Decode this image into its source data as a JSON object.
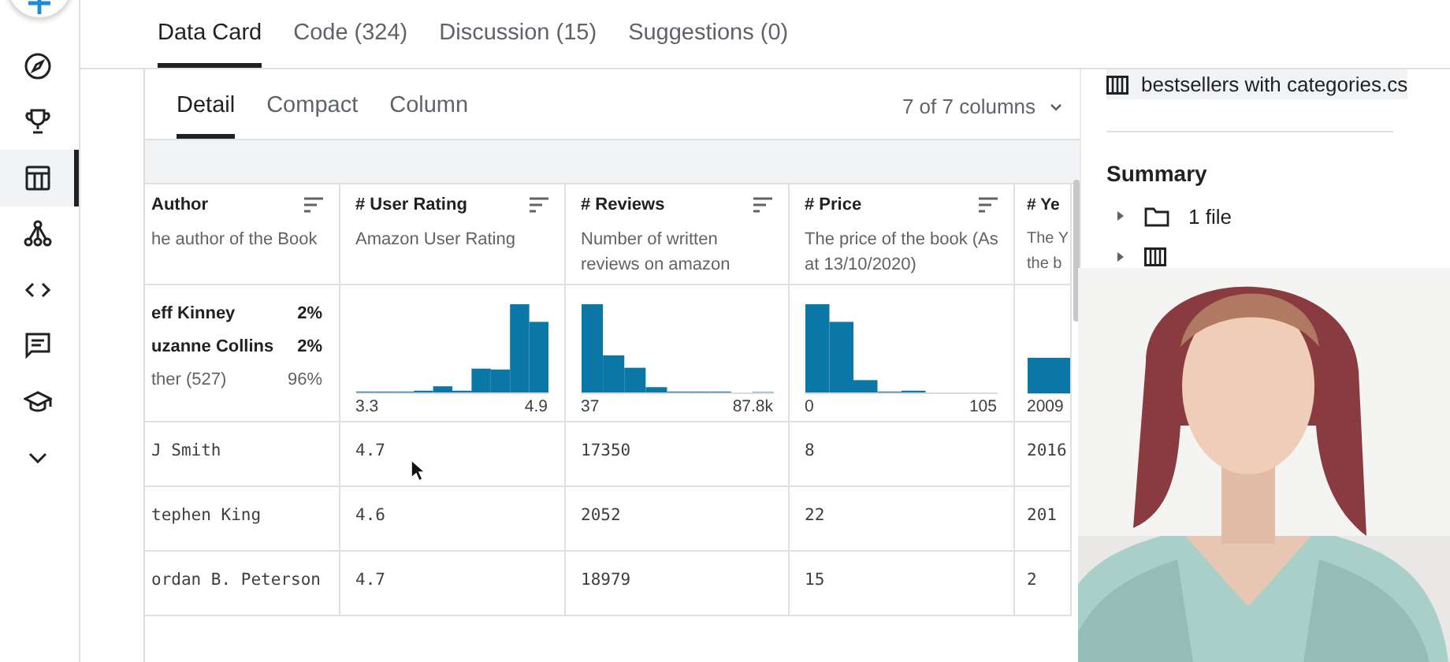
{
  "nav_rail": {
    "items": [
      {
        "kind": "compass",
        "selected": false
      },
      {
        "kind": "trophy",
        "selected": false
      },
      {
        "kind": "table",
        "selected": true
      },
      {
        "kind": "network",
        "selected": false
      },
      {
        "kind": "code",
        "selected": false
      },
      {
        "kind": "comments",
        "selected": false
      },
      {
        "kind": "school",
        "selected": false
      },
      {
        "kind": "more",
        "selected": false
      }
    ]
  },
  "tabs": [
    {
      "label": "Data Card",
      "selected": true
    },
    {
      "label": "Code (324)",
      "selected": false
    },
    {
      "label": "Discussion (15)",
      "selected": false
    },
    {
      "label": "Suggestions (0)",
      "selected": false
    }
  ],
  "view_tabs": [
    {
      "label": "Detail",
      "selected": true
    },
    {
      "label": "Compact",
      "selected": false
    },
    {
      "label": "Column",
      "selected": false
    }
  ],
  "columns_menu": "7 of 7 columns",
  "table": {
    "columns": [
      {
        "kind": "text",
        "name": "Author",
        "sortable": true,
        "description": [
          "he author of the Book"
        ],
        "top_values": [
          {
            "label": "eff Kinney",
            "share": "2%",
            "kind": "value"
          },
          {
            "label": "uzanne Collins",
            "share": "2%",
            "kind": "value"
          },
          {
            "label": "ther (527)",
            "share": "96%",
            "kind": "other"
          }
        ]
      },
      {
        "kind": "numeric",
        "type_mark": "#",
        "name": "User Rating",
        "sortable": true,
        "description": [
          "Amazon User Rating"
        ],
        "axis_min": "3.3",
        "axis_max": "4.9"
      },
      {
        "kind": "numeric",
        "type_mark": "#",
        "name": "Reviews",
        "sortable": true,
        "description": [
          "Number of written",
          "reviews on amazon"
        ],
        "axis_min": "37",
        "axis_max": "87.8k"
      },
      {
        "kind": "numeric",
        "type_mark": "#",
        "name": "Price",
        "sortable": true,
        "description": [
          "The price of the book (As",
          "at 13/10/2020)"
        ],
        "axis_min": "0",
        "axis_max": "105"
      },
      {
        "kind": "numeric",
        "type_mark": "#",
        "name": "Ye",
        "sortable": false,
        "description": [
          "The Y",
          "the b"
        ],
        "axis_min": "2009"
      }
    ],
    "rows": [
      {
        "cells": [
          "J Smith",
          "4.7",
          "17350",
          "8",
          "2016"
        ]
      },
      {
        "cells": [
          "tephen King",
          "4.6",
          "2052",
          "22",
          "201"
        ]
      },
      {
        "cells": [
          "ordan B. Peterson",
          "4.7",
          "18979",
          "15",
          "2"
        ]
      }
    ]
  },
  "sidebar": {
    "file": "bestsellers with categories.cs",
    "summary_title": "Summary",
    "summary_items": [
      {
        "kind": "folder",
        "label": "1 file"
      },
      {
        "kind": "table"
      }
    ]
  }
}
